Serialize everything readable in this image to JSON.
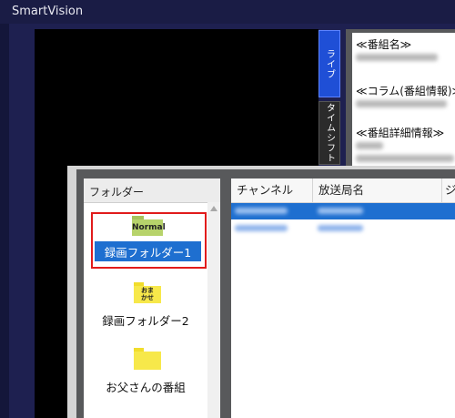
{
  "window": {
    "title": "SmartVision"
  },
  "side_tabs": {
    "live": "ライブ",
    "timeshift": "タイムシフト"
  },
  "info": {
    "program_name_heading": "≪番組名≫",
    "column_heading": "≪コラム(番組情報)≫",
    "detail_heading": "≪番組詳細情報≫"
  },
  "folder_panel": {
    "header": "フォルダー",
    "items": [
      {
        "label": "録画フォルダー1",
        "icon": "folder-normal-icon",
        "icon_text": "Normal",
        "selected": true
      },
      {
        "label": "録画フォルダー2",
        "icon": "folder-omakase-icon",
        "icon_text": "おま\nかせ",
        "selected": false
      },
      {
        "label": "お父さんの番組",
        "icon": "folder-icon",
        "icon_text": "",
        "selected": false
      }
    ]
  },
  "list": {
    "columns": [
      "チャンネル",
      "放送局名",
      "ジ"
    ]
  },
  "colors": {
    "background": "#14163a",
    "selection": "#1e6fd0",
    "highlight_border": "#e11b1b",
    "live_tab": "#1f4fd6"
  }
}
